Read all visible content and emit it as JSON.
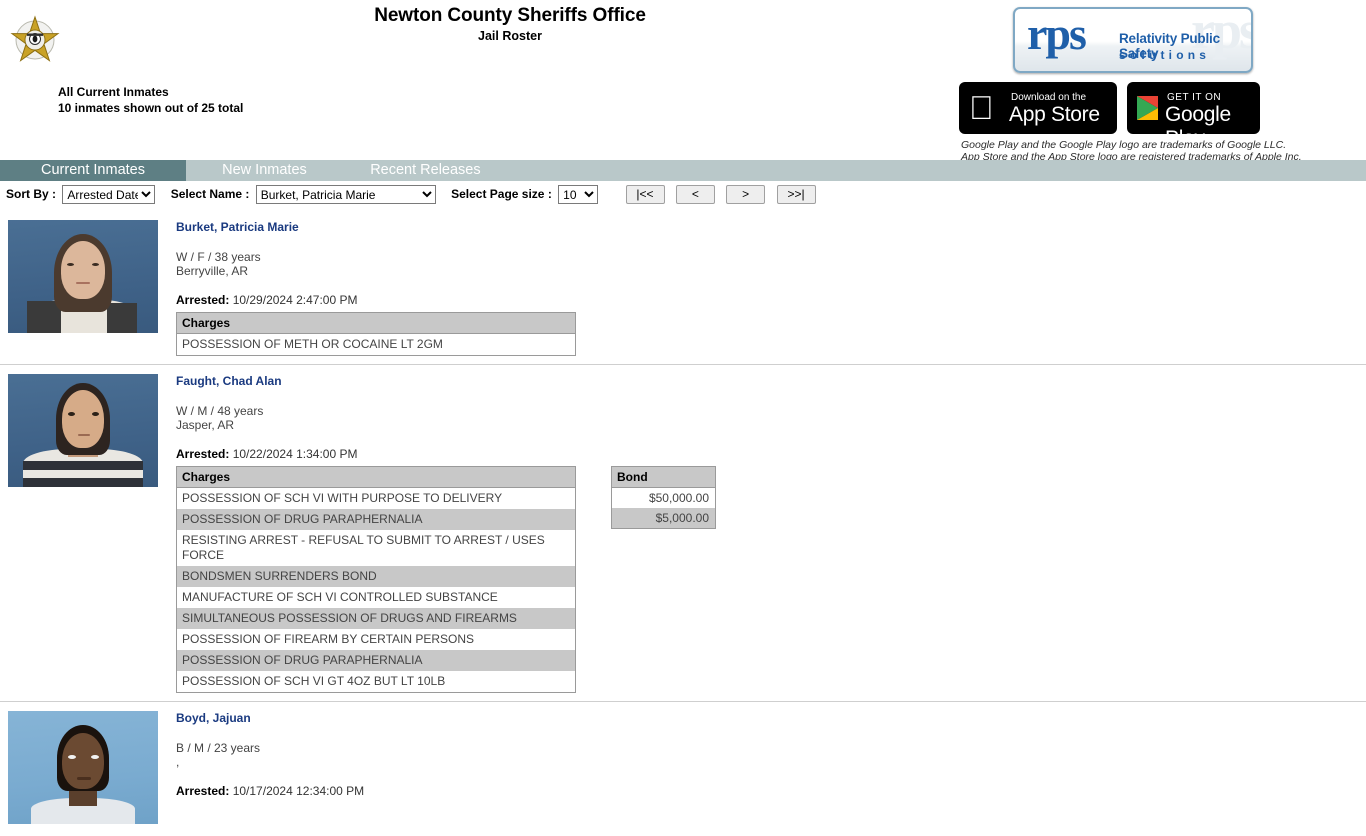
{
  "header": {
    "badge_icon": "sheriff-star-badge-icon",
    "title": "Newton County Sheriffs Office",
    "subtitle": "Jail Roster",
    "roster_scope": "All Current Inmates",
    "roster_count": "10 inmates shown out of 25 total"
  },
  "branding": {
    "rps_mark": "rps",
    "rps_line1": "Relativity Public Safety",
    "rps_line2": "solutions",
    "rps_ghost": "rps",
    "app_store": {
      "icon": "apple-logo-icon",
      "top_label": "Download on the",
      "bottom_label": "App Store"
    },
    "google_play": {
      "icon": "google-play-triangle-icon",
      "top_label": "GET IT ON",
      "bottom_label": "Google Play"
    },
    "legal_line1": "Google Play and the Google Play logo are trademarks of Google LLC.",
    "legal_line2": "App Store and the App Store logo are registered trademarks of Apple Inc."
  },
  "tabs": [
    {
      "label": "Current Inmates",
      "active": true
    },
    {
      "label": "New Inmates",
      "active": false
    },
    {
      "label": "Recent Releases",
      "active": false
    }
  ],
  "controls": {
    "sort_by_label": "Sort By :",
    "sort_by_value": "Arrested Date",
    "sort_by_options": [
      "Arrested Date"
    ],
    "select_name_label": "Select Name :",
    "select_name_value": "Burket, Patricia Marie",
    "select_name_options": [
      "Burket, Patricia Marie"
    ],
    "page_size_label": "Select Page size :",
    "page_size_value": "10",
    "page_size_options": [
      "10"
    ],
    "pager": {
      "first": "|<<",
      "prev": "<",
      "next": ">",
      "last": ">>|"
    }
  },
  "table_headers": {
    "charges": "Charges",
    "bond": "Bond"
  },
  "inmates": [
    {
      "name": "Burket, Patricia Marie",
      "demographics": "W / F / 38 years",
      "city_state": "Berryville, AR",
      "arrested_label": "Arrested:",
      "arrested_value": "10/29/2024 2:47:00 PM",
      "mugshot_bg": "dark-blue",
      "charges": [
        "POSSESSION OF METH OR COCAINE LT 2GM"
      ],
      "bonds": []
    },
    {
      "name": "Faught, Chad Alan",
      "demographics": "W / M / 48 years",
      "city_state": "Jasper, AR",
      "arrested_label": "Arrested:",
      "arrested_value": "10/22/2024 1:34:00 PM",
      "mugshot_bg": "dark-blue",
      "charges": [
        "POSSESSION OF SCH VI WITH PURPOSE TO DELIVERY",
        "POSSESSION OF DRUG PARAPHERNALIA",
        "RESISTING ARREST - REFUSAL TO SUBMIT TO ARREST / USES FORCE",
        "BONDSMEN SURRENDERS BOND",
        "MANUFACTURE OF SCH VI CONTROLLED SUBSTANCE",
        "SIMULTANEOUS POSSESSION OF DRUGS AND FIREARMS",
        "POSSESSION OF FIREARM BY CERTAIN PERSONS",
        "POSSESSION OF DRUG PARAPHERNALIA",
        "POSSESSION OF SCH VI GT 4OZ BUT LT 10LB"
      ],
      "bonds": [
        "$50,000.00",
        "$5,000.00"
      ]
    },
    {
      "name": "Boyd, Jajuan",
      "demographics": "B / M / 23 years",
      "city_state": ",",
      "arrested_label": "Arrested:",
      "arrested_value": "10/17/2024 12:34:00 PM",
      "mugshot_bg": "light-blue",
      "charges": [],
      "bonds": []
    }
  ],
  "colors": {
    "tab_active_bg": "#5e7f84",
    "tab_bar_bg": "#b9c8c9",
    "name_link": "#1a3a80",
    "table_header_bg": "#c8c8c8",
    "row_alt_bg": "#c8c8c8",
    "rps_blue": "#1f5fa9"
  }
}
